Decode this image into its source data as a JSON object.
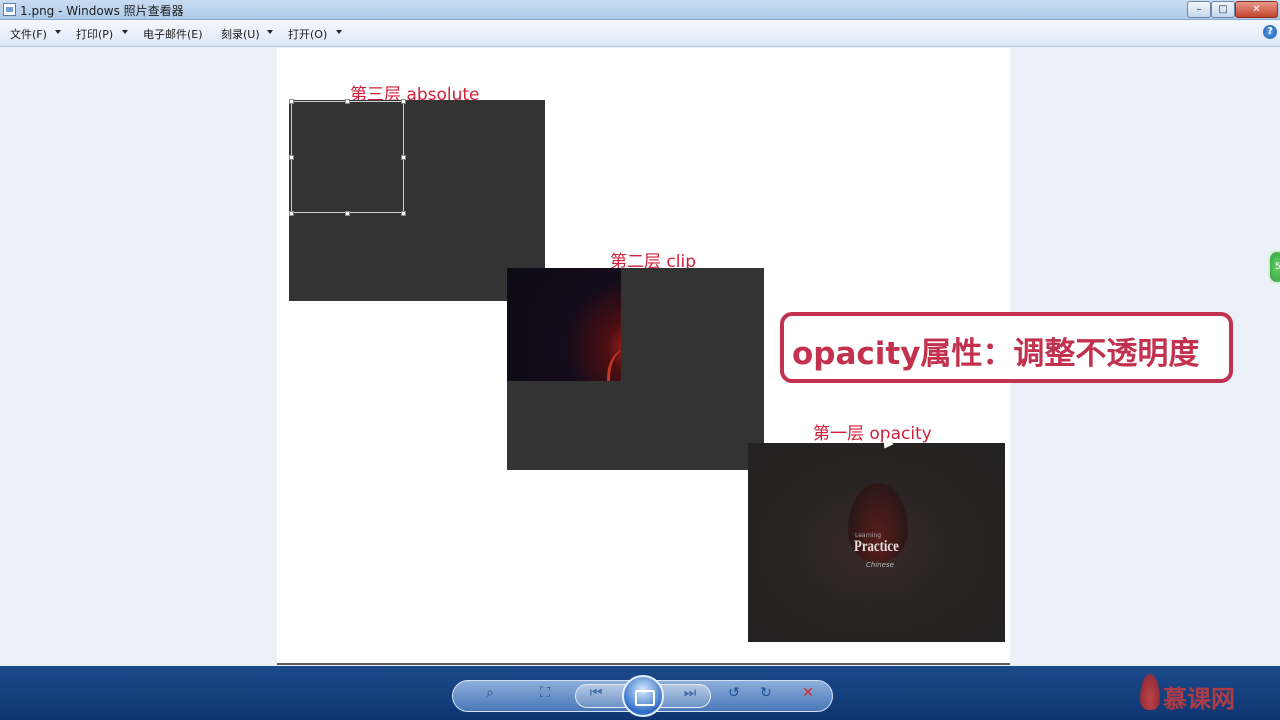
{
  "window": {
    "title": "1.png - Windows 照片查看器",
    "min": "–",
    "max": "□",
    "close": "✕"
  },
  "menu": {
    "items": [
      "文件(F)",
      "打印(P)",
      "电子邮件(E)",
      "刻录(U)",
      "打开(O)"
    ],
    "help": "?"
  },
  "image": {
    "layer3_label": "第三层 absolute",
    "layer2_label": "第二层 clip",
    "layer1_label": "第一层 opacity",
    "photo_small": "Learning",
    "photo_title": "Practice",
    "photo_script": "Chinese"
  },
  "callout": {
    "text": "opacity属性：调整不透明度"
  },
  "side_badge": "5",
  "toolbar": {
    "zoom_icon": "⌕",
    "fit_icon": "⛶",
    "prev_icon": "⏮",
    "next_icon": "⏭",
    "rotate_ccw_icon": "↺",
    "rotate_cw_icon": "↻",
    "delete_icon": "✕"
  },
  "brand": "慕课网",
  "colors": {
    "label_red": "#d1203a",
    "callout": "#c2324e",
    "dark_layer": "#333333"
  }
}
